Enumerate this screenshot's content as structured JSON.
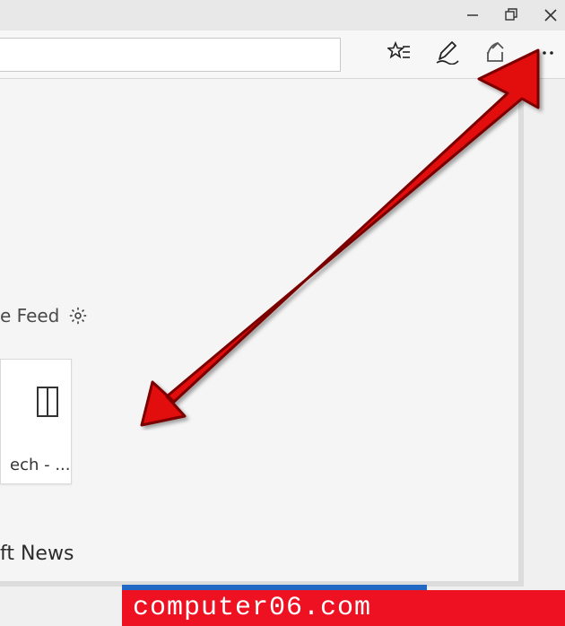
{
  "window_controls": {
    "minimize": "minimize",
    "maximize": "maximize",
    "close": "close"
  },
  "toolbar": {
    "favorites": "favorites",
    "notes": "web-notes",
    "share": "share",
    "more": "settings-and-more"
  },
  "feed": {
    "label_fragment": "e Feed",
    "settings": "feed-settings"
  },
  "tile": {
    "label_fragment": "ech - ..."
  },
  "news": {
    "label_fragment": "ft News"
  },
  "watermark": {
    "text": "computer06.com"
  }
}
